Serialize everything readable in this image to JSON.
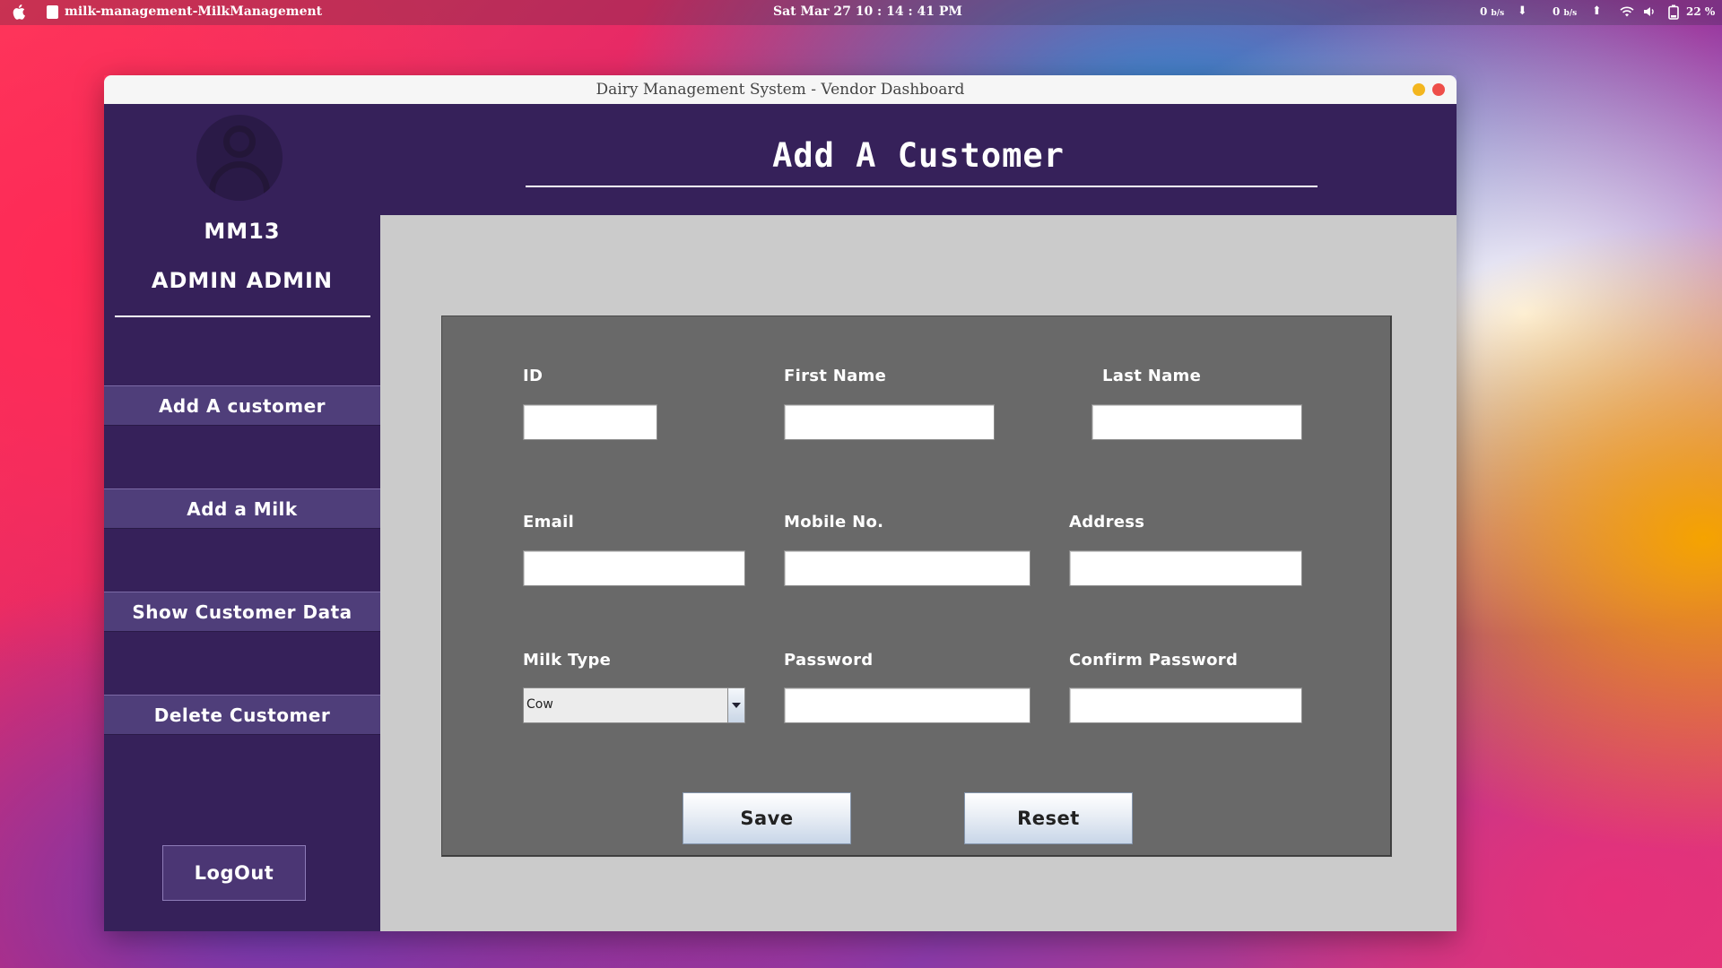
{
  "menubar": {
    "app_title": "milk-management-MilkManagement",
    "clock": "Sat Mar 27  10 : 14 : 41 PM",
    "net_down_value": "0",
    "net_down_unit": "b/s",
    "net_up_value": "0",
    "net_up_unit": "b/s",
    "battery": "22 %"
  },
  "window": {
    "title": "Dairy Management System - Vendor Dashboard"
  },
  "sidebar": {
    "user_id": "MM13",
    "user_name": "ADMIN ADMIN",
    "nav": [
      {
        "label": "Add A customer"
      },
      {
        "label": "Add a Milk"
      },
      {
        "label": "Show Customer Data"
      },
      {
        "label": "Delete Customer"
      }
    ],
    "logout_label": "LogOut"
  },
  "main": {
    "title": "Add A Customer",
    "form": {
      "id_label": "ID",
      "first_name_label": "First Name",
      "last_name_label": "Last Name",
      "email_label": "Email",
      "mobile_label": "Mobile No.",
      "address_label": "Address",
      "milk_type_label": "Milk Type",
      "milk_type_value": "Cow",
      "password_label": "Password",
      "confirm_password_label": "Confirm Password",
      "id_value": "",
      "first_name_value": "",
      "last_name_value": "",
      "email_value": "",
      "mobile_value": "",
      "address_value": "",
      "password_value": "",
      "confirm_password_value": ""
    },
    "save_label": "Save",
    "reset_label": "Reset"
  }
}
